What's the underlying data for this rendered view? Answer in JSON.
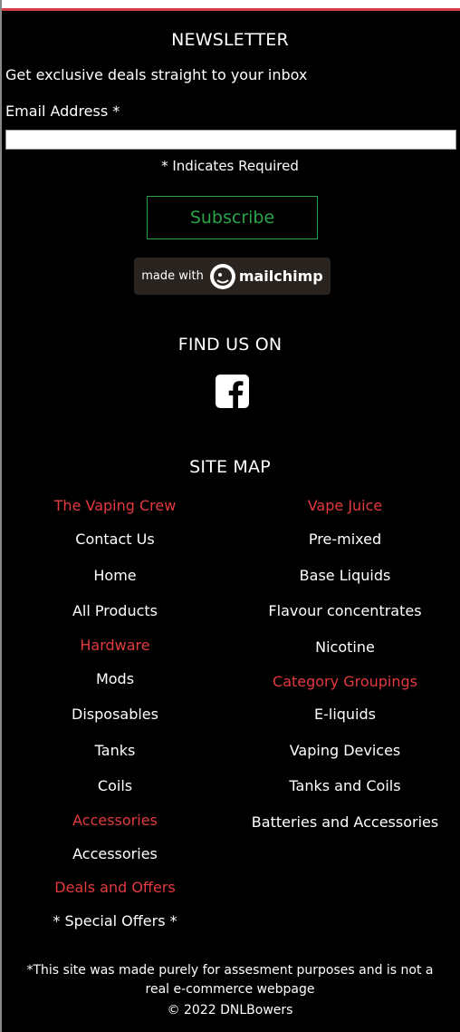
{
  "newsletter": {
    "title": "NEWSLETTER",
    "intro": "Get exclusive deals straight to your inbox",
    "email_label": "Email Address *",
    "email_value": "",
    "required_note": "* Indicates Required",
    "subscribe_label": "Subscribe",
    "badge_made_with": "made with",
    "badge_brand": "mailchimp"
  },
  "find_us": {
    "title": "FIND US ON"
  },
  "sitemap": {
    "title": "SITE MAP",
    "left": [
      {
        "label": "The Vaping Crew",
        "heading": true
      },
      {
        "label": "Contact Us",
        "heading": false
      },
      {
        "label": "Home",
        "heading": false
      },
      {
        "label": "All Products",
        "heading": false
      },
      {
        "label": "Hardware",
        "heading": true
      },
      {
        "label": "Mods",
        "heading": false
      },
      {
        "label": "Disposables",
        "heading": false
      },
      {
        "label": "Tanks",
        "heading": false
      },
      {
        "label": "Coils",
        "heading": false
      },
      {
        "label": "Accessories",
        "heading": true
      },
      {
        "label": "Accessories",
        "heading": false
      },
      {
        "label": "Deals and Offers",
        "heading": true
      },
      {
        "label": "* Special Offers *",
        "heading": false
      }
    ],
    "right": [
      {
        "label": "Vape Juice",
        "heading": true
      },
      {
        "label": "Pre-mixed",
        "heading": false
      },
      {
        "label": "Base Liquids",
        "heading": false
      },
      {
        "label": "Flavour concentrates",
        "heading": false
      },
      {
        "label": "Nicotine",
        "heading": false
      },
      {
        "label": "Category Groupings",
        "heading": true
      },
      {
        "label": "E-liquids",
        "heading": false
      },
      {
        "label": "Vaping Devices",
        "heading": false
      },
      {
        "label": "Tanks and Coils",
        "heading": false
      },
      {
        "label": "Batteries and Accessories",
        "heading": false
      }
    ]
  },
  "footer": {
    "disclaimer": "*This site was made purely for assesment purposes and is not a real e-commerce webpage",
    "copyright": "© 2022 DNLBowers"
  },
  "colors": {
    "background": "#000000",
    "heading_red": "#e23a3f",
    "subscribe_green": "#2aa44a",
    "top_accent": "#d3404c"
  },
  "icons": [
    "facebook-icon",
    "mailchimp-logo-icon"
  ]
}
